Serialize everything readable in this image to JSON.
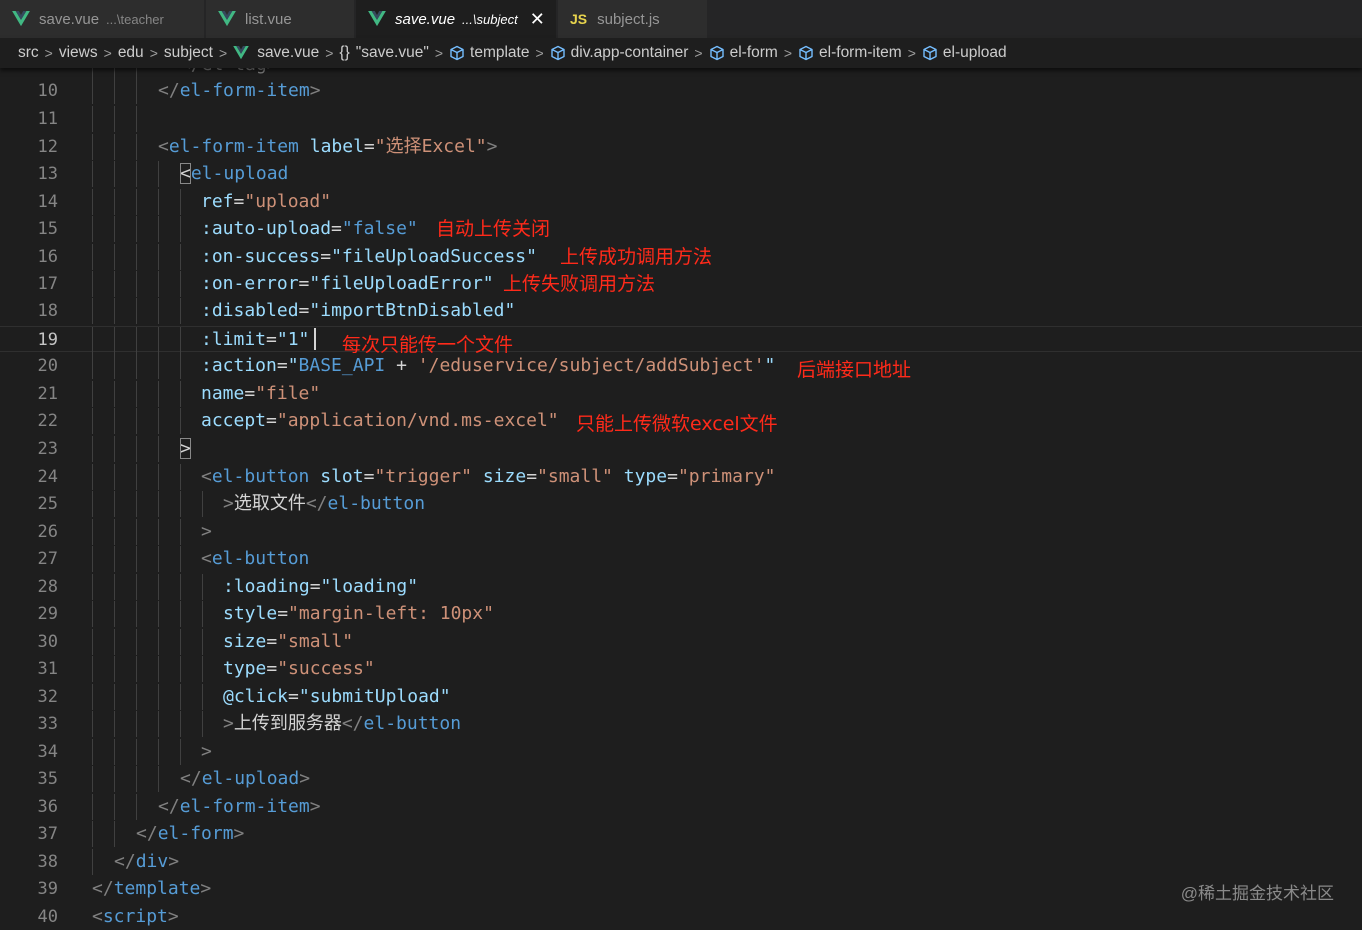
{
  "tabs": [
    {
      "name": "save.vue",
      "desc": "...\\teacher",
      "active": false
    },
    {
      "name": "list.vue",
      "desc": "",
      "active": false
    },
    {
      "name": "save.vue",
      "desc": "...\\subject",
      "active": true,
      "close": "✕"
    },
    {
      "name": "subject.js",
      "desc": "",
      "icon_text": "JS",
      "active": false
    }
  ],
  "breadcrumb": {
    "src": "src",
    "views": "views",
    "edu": "edu",
    "subject": "subject",
    "file": "save.vue",
    "braces": "{}",
    "component": "\"save.vue\"",
    "template": "template",
    "div": "div.app-container",
    "form": "el-form",
    "form_item": "el-form-item",
    "upload": "el-upload",
    "separator": ">"
  },
  "lines": {
    "l10": "10",
    "l11": "11",
    "l12": "12",
    "l13": "13",
    "l14": "14",
    "l15": "15",
    "l16": "16",
    "l17": "17",
    "l18": "18",
    "l19": "19",
    "l20": "20",
    "l21": "21",
    "l22": "22",
    "l23": "23",
    "l24": "24",
    "l25": "25",
    "l26": "26",
    "l27": "27",
    "l28": "28",
    "l29": "29",
    "l30": "30",
    "l31": "31",
    "l32": "32",
    "l33": "33",
    "l34": "34",
    "l35": "35",
    "l36": "36",
    "l37": "37",
    "l38": "38",
    "l39": "39",
    "l40": "40"
  },
  "code": {
    "top_partial": "</el-tag>",
    "el_form_item": "el-form-item",
    "el_upload": "el-upload",
    "el_button": "el-button",
    "el_form": "el-form",
    "div": "div",
    "template": "template",
    "script": "script",
    "label_attr": "label",
    "label_val": "\"选择Excel\"",
    "ref_attr": "ref",
    "ref_val": "\"upload\"",
    "auto_attr": ":auto-upload",
    "auto_val": "\"false\"",
    "success_attr": ":on-success",
    "success_val": "\"fileUploadSuccess\"",
    "error_attr": ":on-error",
    "error_val": "\"fileUploadError\"",
    "disabled_attr": ":disabled",
    "disabled_val": "\"importBtnDisabled\"",
    "limit_attr": ":limit",
    "limit_val": "\"1\"",
    "action_attr": ":action",
    "action_q1": "\"",
    "action_api": "BASE_API",
    "action_plus": " + ",
    "action_str": "'/eduservice/subject/addSubject'",
    "action_q2": "\"",
    "name_attr": "name",
    "name_val": "\"file\"",
    "accept_attr": "accept",
    "accept_val": "\"application/vnd.ms-excel\"",
    "slot_attr": "slot",
    "slot_val": "\"trigger\"",
    "size_attr": "size",
    "size_val": "\"small\"",
    "type_attr": "type",
    "type_val": "\"primary\"",
    "choose_text": "选取文件",
    "loading_attr": ":loading",
    "loading_val": "\"loading\"",
    "style_attr": "style",
    "style_val": "\"margin-left: 10px\"",
    "size2_val": "\"small\"",
    "type2_val": "\"success\"",
    "click_attr": "@click",
    "click_val": "\"submitUpload\"",
    "upload_text": "上传到服务器"
  },
  "notes": {
    "auto_upload": "自动上传关闭",
    "on_success": "上传成功调用方法",
    "on_error": "上传失败调用方法",
    "limit": "每次只能传一个文件",
    "action": "后端接口地址",
    "accept": "只能上传微软excel文件"
  },
  "watermark": "@稀土掘金技术社区",
  "colors": {
    "annotation": "#ff2a1a",
    "tag": "#569cd6",
    "attr": "#9cdcfe",
    "string": "#ce9178",
    "background": "#1e1e1e"
  }
}
